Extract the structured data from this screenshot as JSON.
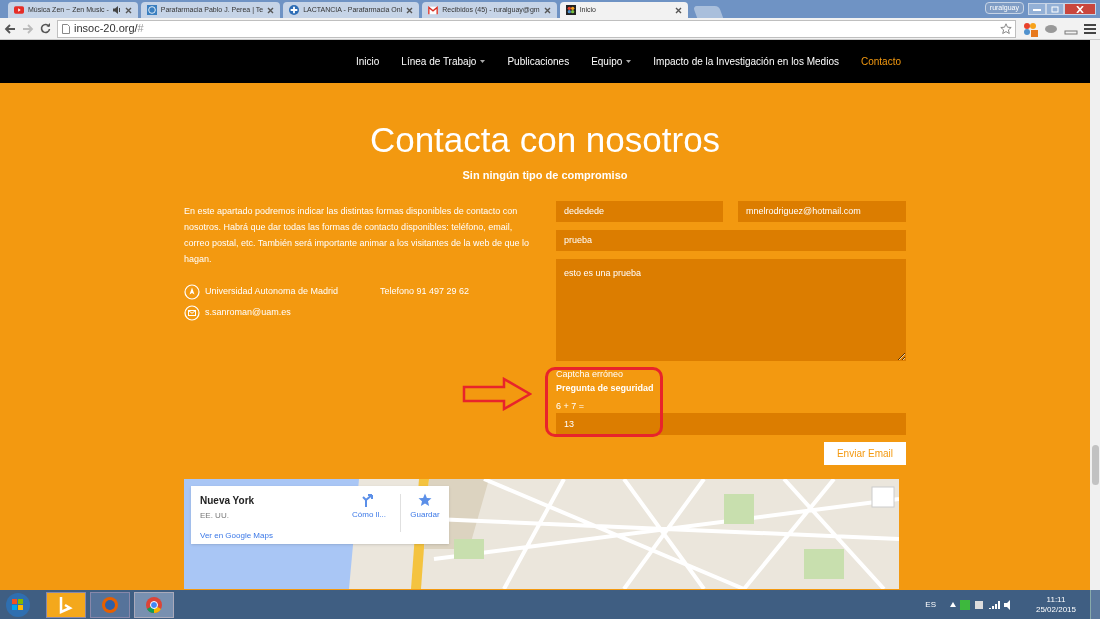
{
  "browser": {
    "tabs": [
      {
        "title": "Música Zen ~ Zen Music -",
        "audio": true,
        "selected": false
      },
      {
        "title": "Parafarmacia Pablo J. Perea | Te",
        "audio": false,
        "selected": false
      },
      {
        "title": "LACTANCIA - Parafarmacia Onl",
        "audio": false,
        "selected": false
      },
      {
        "title": "Recibidos (45) - ruralguay@gm",
        "audio": false,
        "selected": false
      },
      {
        "title": "Inicio",
        "audio": false,
        "selected": true
      }
    ],
    "user": "ruralguay",
    "url_host": "insoc-20.org/",
    "url_rest": "#"
  },
  "nav": [
    {
      "label": "Inicio",
      "dropdown": false,
      "selected": false
    },
    {
      "label": "Línea de Trabajo",
      "dropdown": true,
      "selected": false
    },
    {
      "label": "Publicaciones",
      "dropdown": false,
      "selected": false
    },
    {
      "label": "Equipo",
      "dropdown": true,
      "selected": false
    },
    {
      "label": "Impacto de la Investigación en los Medios",
      "dropdown": false,
      "selected": false
    },
    {
      "label": "Contacto",
      "dropdown": false,
      "selected": true
    }
  ],
  "heading": "Contacta con nosotros",
  "subheading": "Sin ningún tipo de compromiso",
  "intro": "En este apartado podremos indicar las distintas formas disponibles de contacto con nosotros. Habrá que dar todas las formas de contacto disponibles: teléfono, email, correo postal, etc. También será importante animar a los visitantes de la web de que lo hagan.",
  "address": "Universidad Autonoma de Madrid",
  "phone": "Telefono 91 497 29 62",
  "email": "s.sanroman@uam.es",
  "form": {
    "name": "dededede",
    "email": "mnelrodriguez@hotmail.com",
    "subject": "prueba",
    "message": "esto es una prueba",
    "captcha_error": "Captcha erróneo",
    "captcha_title": "Pregunta de seguridad",
    "captcha_question": "6 + 7 =",
    "captcha_answer": "13",
    "submit": "Enviar Email"
  },
  "map": {
    "kind": "picture",
    "place": "Nueva York",
    "country": "EE. UU.",
    "directions": "Cómo ll...",
    "save": "Guardar",
    "link": "Ver en Google Maps"
  },
  "taskbar": {
    "language": "ES",
    "time": "11:11",
    "date": "25/02/2015"
  }
}
